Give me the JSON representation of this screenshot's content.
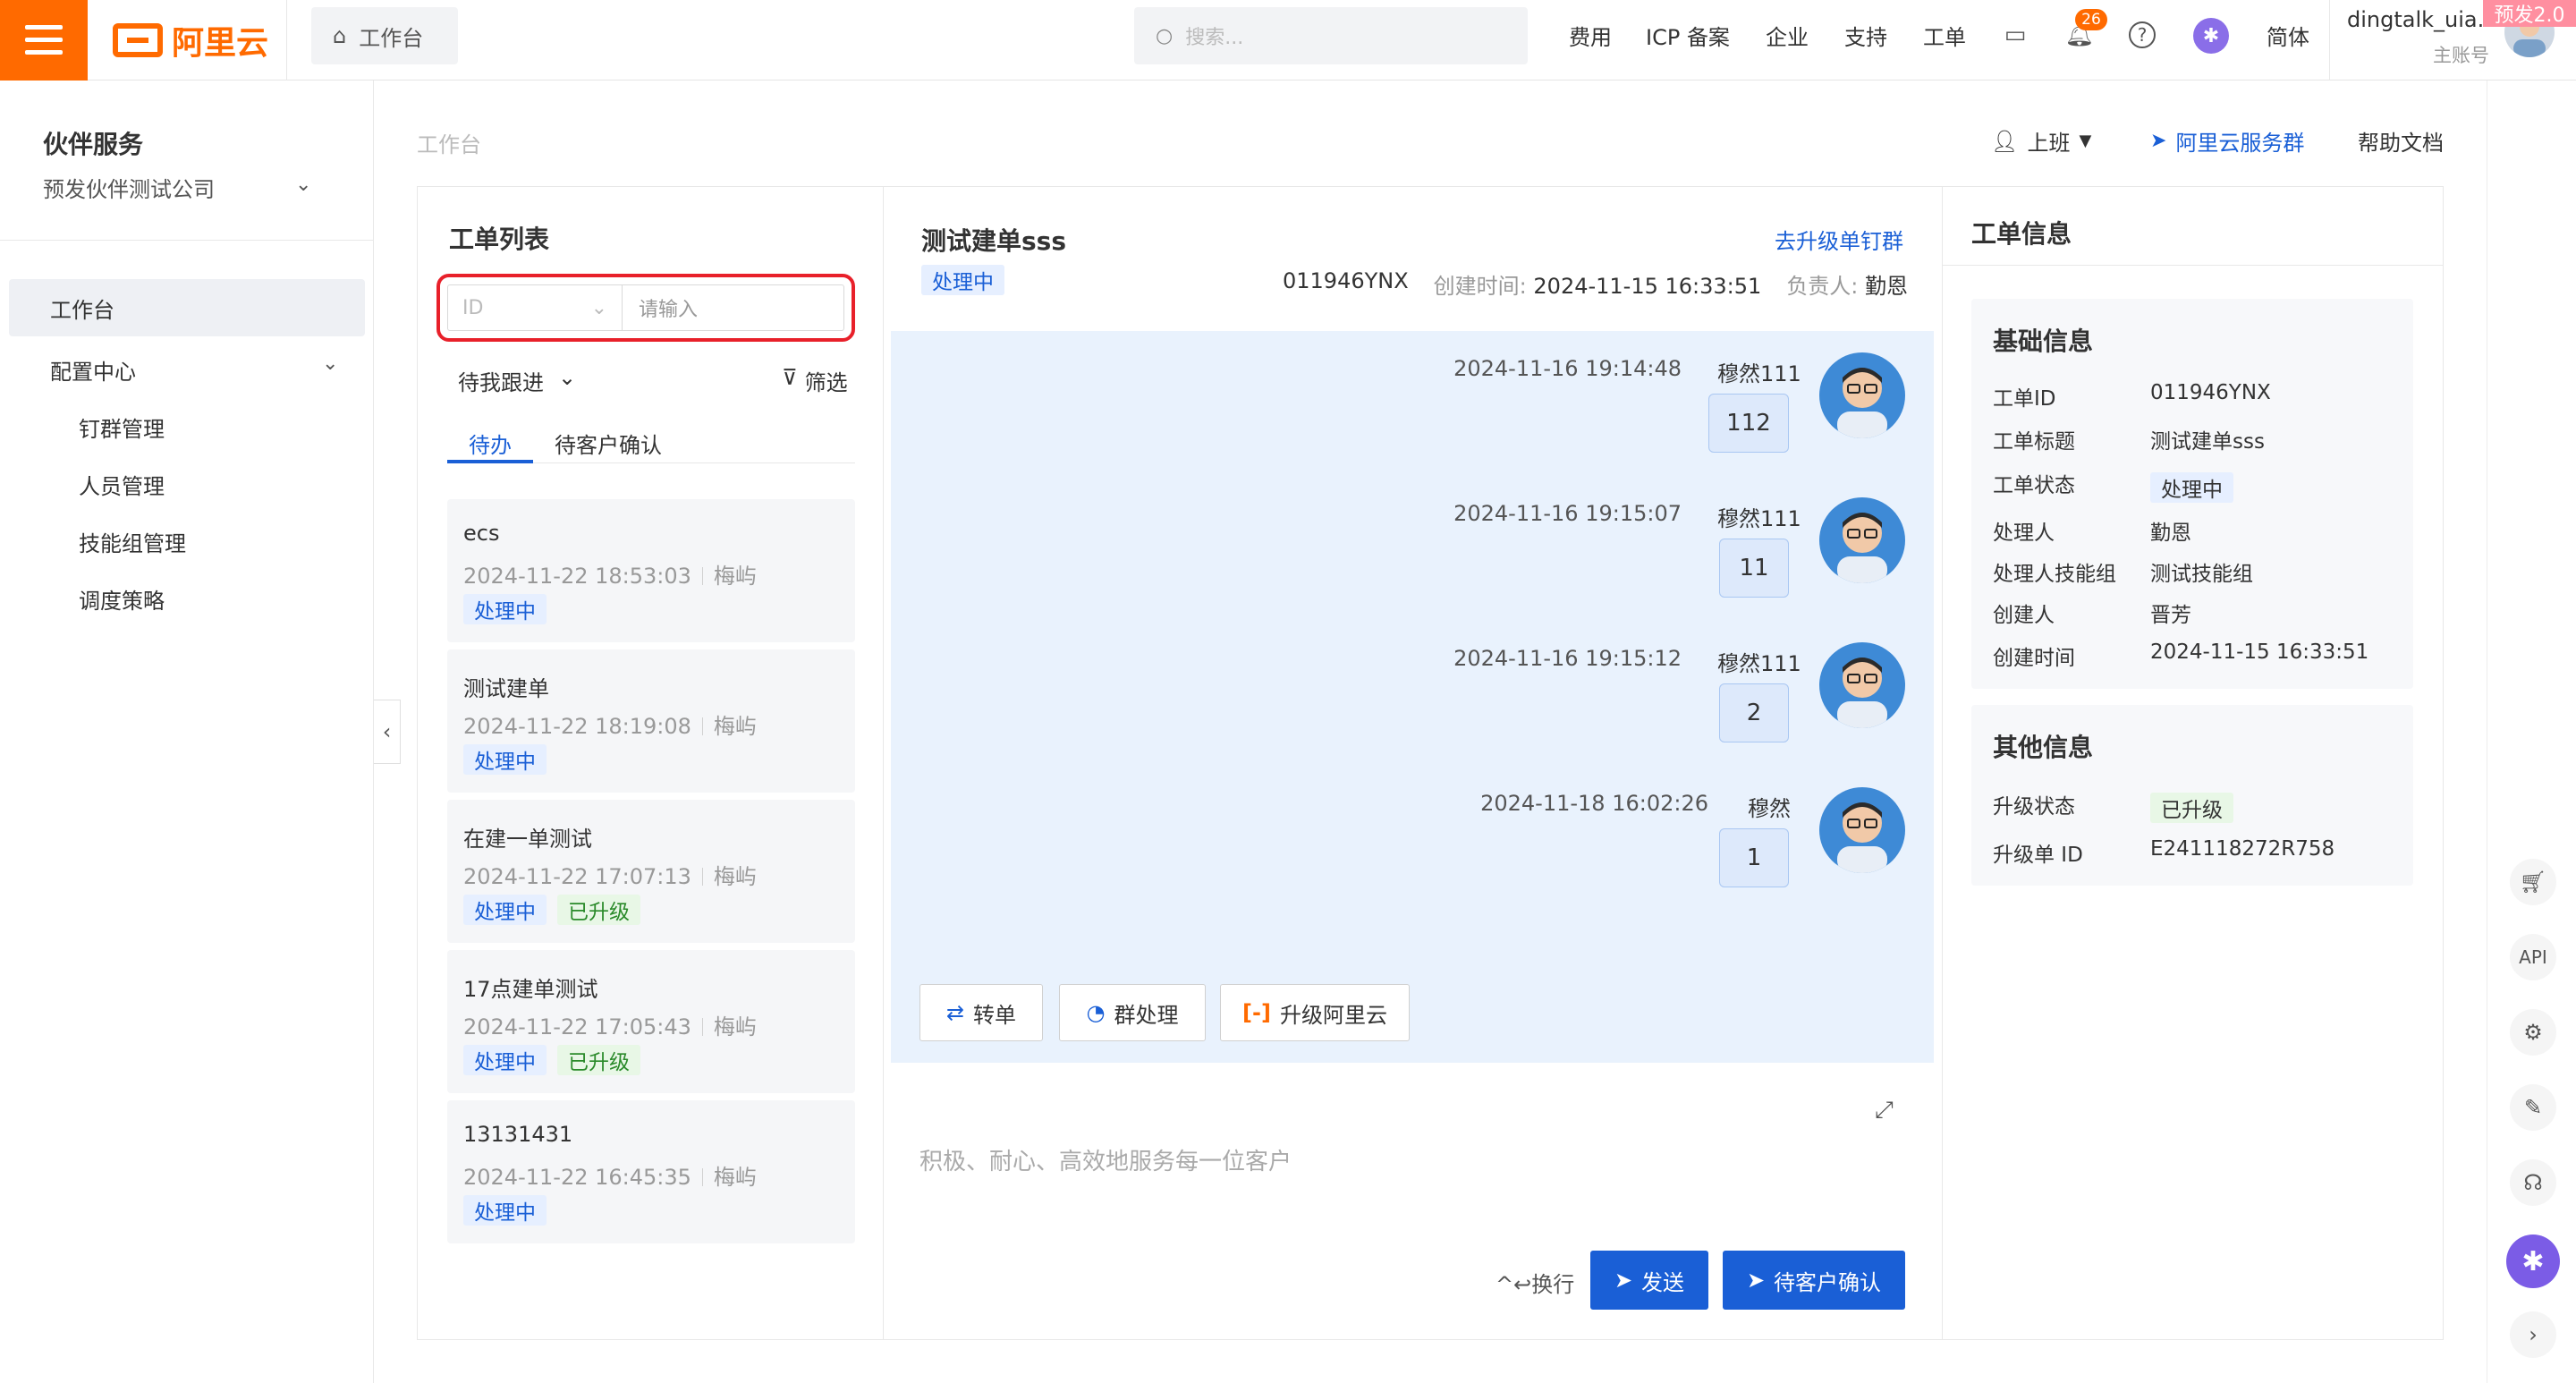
{
  "topbar": {
    "logo_text": "阿里云",
    "home_tab": "工作台",
    "search_placeholder": "搜索...",
    "links": [
      "费用",
      "ICP 备案",
      "企业",
      "支持",
      "工单"
    ],
    "lang": "简体",
    "notification_count": "26",
    "user_name": "dingtalk_uia...",
    "user_role": "主账号",
    "env_badge": "预发2.0"
  },
  "sidebar": {
    "title": "伙伴服务",
    "org": "预发伙伴测试公司",
    "items": [
      {
        "label": "工作台"
      },
      {
        "label": "配置中心"
      },
      {
        "label": "钉群管理"
      },
      {
        "label": "人员管理"
      },
      {
        "label": "技能组管理"
      },
      {
        "label": "调度策略"
      }
    ]
  },
  "breadcrumb": "工作台",
  "header_actions": {
    "on_duty": "上班",
    "service_group": "阿里云服务群",
    "help": "帮助文档"
  },
  "ticket_list": {
    "title": "工单列表",
    "id_select": "ID",
    "input_placeholder": "请输入",
    "follow_filter": "待我跟进",
    "filter_label": "筛选",
    "tabs": [
      "待办",
      "待客户确认"
    ],
    "tickets": [
      {
        "title": "ecs",
        "time": "2024-11-22 18:53:03",
        "owner": "梅屿",
        "status": "处理中",
        "upgraded": ""
      },
      {
        "title": "测试建单",
        "time": "2024-11-22 18:19:08",
        "owner": "梅屿",
        "status": "处理中",
        "upgraded": ""
      },
      {
        "title": "在建一单测试",
        "time": "2024-11-22 17:07:13",
        "owner": "梅屿",
        "status": "处理中",
        "upgraded": "已升级"
      },
      {
        "title": "17点建单测试",
        "time": "2024-11-22 17:05:43",
        "owner": "梅屿",
        "status": "处理中",
        "upgraded": "已升级"
      },
      {
        "title": "13131431",
        "time": "2024-11-22 16:45:35",
        "owner": "梅屿",
        "status": "处理中",
        "upgraded": ""
      }
    ]
  },
  "chat": {
    "title": "测试建单sss",
    "status": "处理中",
    "upgrade_link": "去升级单钉群",
    "ticket_id": "011946YNX",
    "created_label": "创建时间:",
    "created_value": "2024-11-15 16:33:51",
    "owner_label": "负责人:",
    "owner_value": "勤恩",
    "messages": [
      {
        "time": "2024-11-16 19:14:48",
        "user": "穆然111",
        "text": "112"
      },
      {
        "time": "2024-11-16 19:15:07",
        "user": "穆然111",
        "text": "11"
      },
      {
        "time": "2024-11-16 19:15:12",
        "user": "穆然111",
        "text": "2"
      },
      {
        "time": "2024-11-18 16:02:26",
        "user": "穆然",
        "text": "1"
      }
    ],
    "actions": [
      "转单",
      "群处理",
      "升级阿里云"
    ],
    "composer_placeholder": "积极、耐心、高效地服务每一位客户",
    "newline_hint": "^↩换行",
    "send": "发送",
    "pending_confirm": "待客户确认"
  },
  "info": {
    "title": "工单信息",
    "basic_title": "基础信息",
    "basic": [
      {
        "k": "工单ID",
        "v": "011946YNX"
      },
      {
        "k": "工单标题",
        "v": "测试建单sss"
      },
      {
        "k": "工单状态",
        "v": "处理中"
      },
      {
        "k": "处理人",
        "v": "勤恩"
      },
      {
        "k": "处理人技能组",
        "v": "测试技能组"
      },
      {
        "k": "创建人",
        "v": "晋芳"
      },
      {
        "k": "创建时间",
        "v": "2024-11-15 16:33:51"
      }
    ],
    "other_title": "其他信息",
    "other": [
      {
        "k": "升级状态",
        "v": "已升级"
      },
      {
        "k": "升级单 ID",
        "v": "E241118272R758"
      }
    ]
  },
  "colors": {
    "brand": "#ff6a00",
    "primary": "#1a5fd6",
    "highlight_border": "#e8202a",
    "chat_bg": "#e9f2fd"
  },
  "icons": [
    "menu-icon",
    "home-icon",
    "search-icon",
    "terminal-icon",
    "bell-icon",
    "help-icon",
    "ai-assistant-icon",
    "cart-icon",
    "api-icon",
    "settings-icon",
    "edit-icon",
    "headset-icon",
    "chevron-right-icon"
  ]
}
